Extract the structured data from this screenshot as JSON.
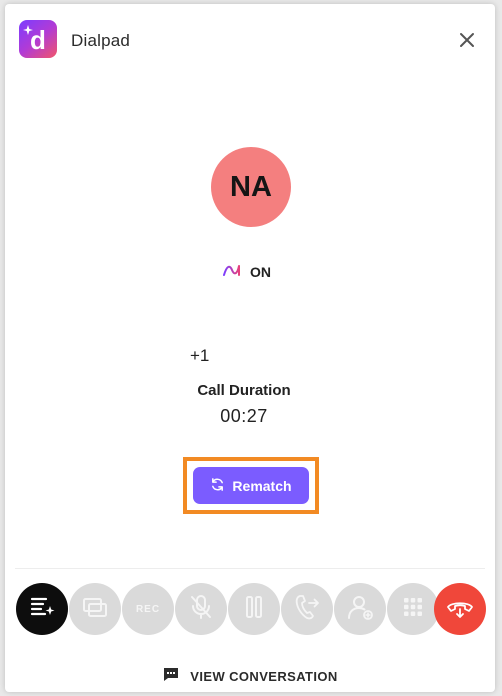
{
  "app": {
    "title": "Dialpad",
    "logo_letter": "d"
  },
  "contact": {
    "initials": "NA",
    "phone_prefix": "+1"
  },
  "ai_status": {
    "label": "ON"
  },
  "call": {
    "duration_label": "Call Duration",
    "duration_value": "00:27"
  },
  "actions": {
    "rematch_label": "Rematch"
  },
  "controls": [
    {
      "icon": "ai-recap-icon",
      "state": "active"
    },
    {
      "icon": "screen-share-icon",
      "state": "disabled"
    },
    {
      "icon": "record-icon",
      "label": "REC",
      "state": "disabled"
    },
    {
      "icon": "mic-muted-icon",
      "state": "disabled"
    },
    {
      "icon": "pause-icon",
      "state": "disabled"
    },
    {
      "icon": "transfer-call-icon",
      "state": "disabled"
    },
    {
      "icon": "add-participant-icon",
      "state": "disabled"
    },
    {
      "icon": "keypad-icon",
      "state": "disabled"
    },
    {
      "icon": "hang-up-icon",
      "state": "active"
    }
  ],
  "footer": {
    "view_conversation_label": "VIEW CONVERSATION"
  },
  "colors": {
    "avatar": "#f47f7f",
    "rematch_button": "#7b5cff",
    "highlight_outline": "#f28a23",
    "hang_up": "#f0473a",
    "control_disabled": "#dadada"
  }
}
